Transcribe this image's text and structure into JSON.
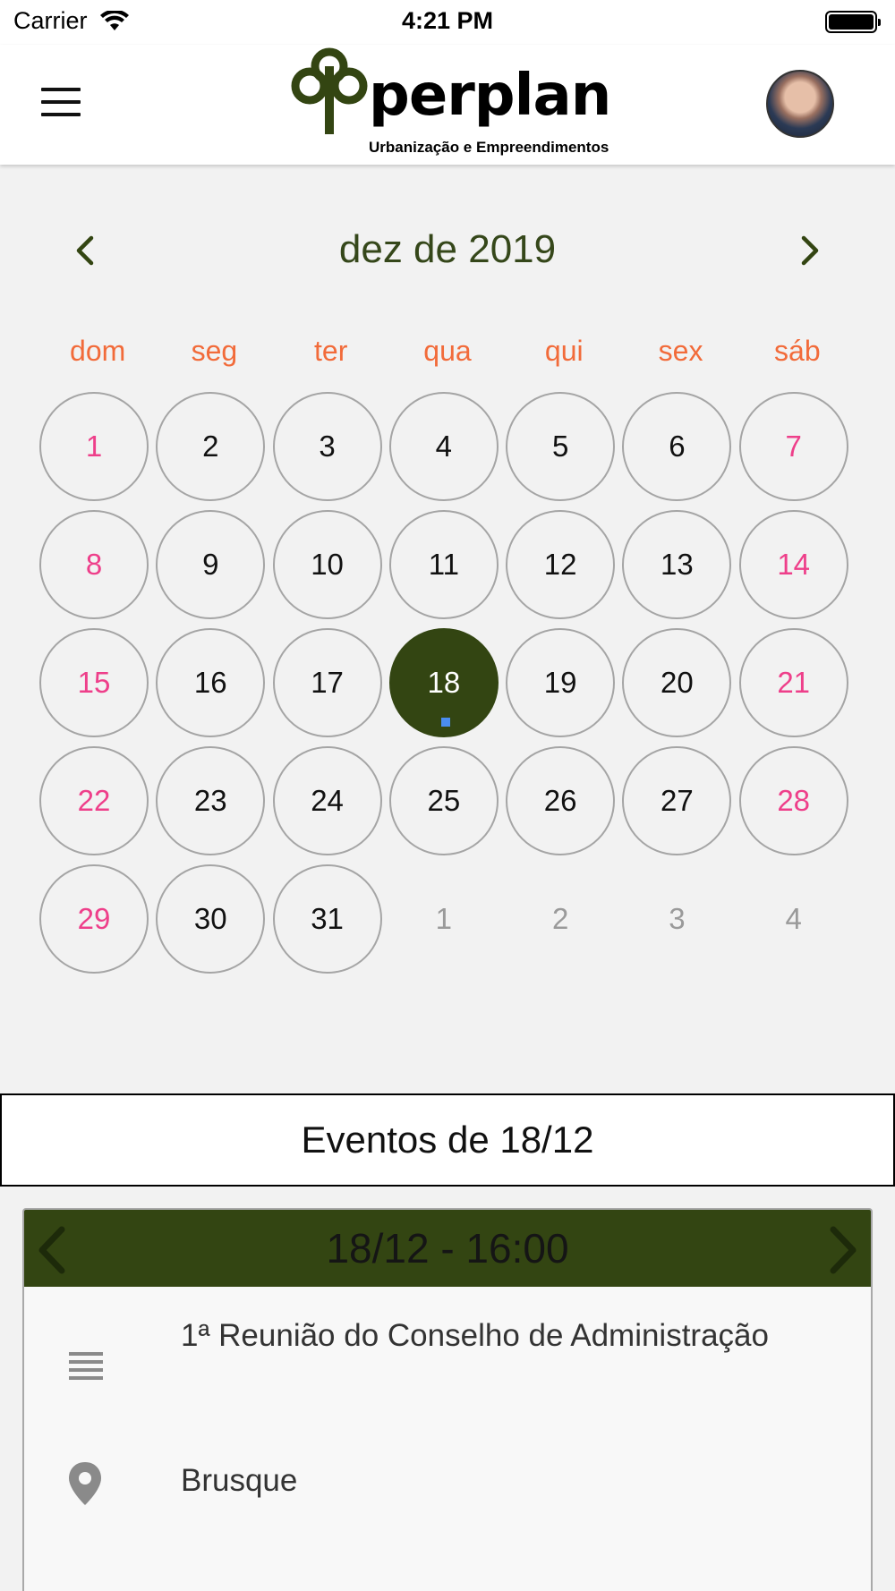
{
  "status_bar": {
    "carrier": "Carrier",
    "time": "4:21 PM"
  },
  "header": {
    "logo_text": "perplan",
    "logo_subtitle": "Urbanização e Empreendimentos",
    "menu_icon": "hamburger-menu-icon",
    "avatar": "user-avatar"
  },
  "calendar": {
    "month_title": "dez de 2019",
    "prev_icon": "chevron-left-icon",
    "next_icon": "chevron-right-icon",
    "weekdays": [
      "dom",
      "seg",
      "ter",
      "qua",
      "qui",
      "sex",
      "sáb"
    ],
    "weeks": [
      [
        {
          "d": "1",
          "type": "weekend"
        },
        {
          "d": "2"
        },
        {
          "d": "3"
        },
        {
          "d": "4"
        },
        {
          "d": "5"
        },
        {
          "d": "6"
        },
        {
          "d": "7",
          "type": "weekend"
        }
      ],
      [
        {
          "d": "8",
          "type": "weekend"
        },
        {
          "d": "9"
        },
        {
          "d": "10"
        },
        {
          "d": "11"
        },
        {
          "d": "12"
        },
        {
          "d": "13"
        },
        {
          "d": "14",
          "type": "weekend"
        }
      ],
      [
        {
          "d": "15",
          "type": "weekend"
        },
        {
          "d": "16"
        },
        {
          "d": "17"
        },
        {
          "d": "18",
          "type": "selected",
          "has_event": true
        },
        {
          "d": "19"
        },
        {
          "d": "20"
        },
        {
          "d": "21",
          "type": "weekend"
        }
      ],
      [
        {
          "d": "22",
          "type": "weekend"
        },
        {
          "d": "23"
        },
        {
          "d": "24"
        },
        {
          "d": "25"
        },
        {
          "d": "26"
        },
        {
          "d": "27"
        },
        {
          "d": "28",
          "type": "weekend"
        }
      ],
      [
        {
          "d": "29",
          "type": "weekend"
        },
        {
          "d": "30"
        },
        {
          "d": "31"
        },
        {
          "d": "1",
          "type": "other"
        },
        {
          "d": "2",
          "type": "other"
        },
        {
          "d": "3",
          "type": "other"
        },
        {
          "d": "4",
          "type": "other"
        }
      ]
    ],
    "colors": {
      "accent": "#334512",
      "weekday_label": "#f26b3a",
      "weekend_day": "#ee3f8a",
      "event_dot": "#4a8df0"
    }
  },
  "events": {
    "title": "Eventos de 18/12",
    "card": {
      "datetime": "18/12 - 16:00",
      "description": "1ª Reunião do Conselho de Administração",
      "location": "Brusque",
      "description_icon": "text-lines-icon",
      "location_icon": "location-pin-icon"
    }
  }
}
